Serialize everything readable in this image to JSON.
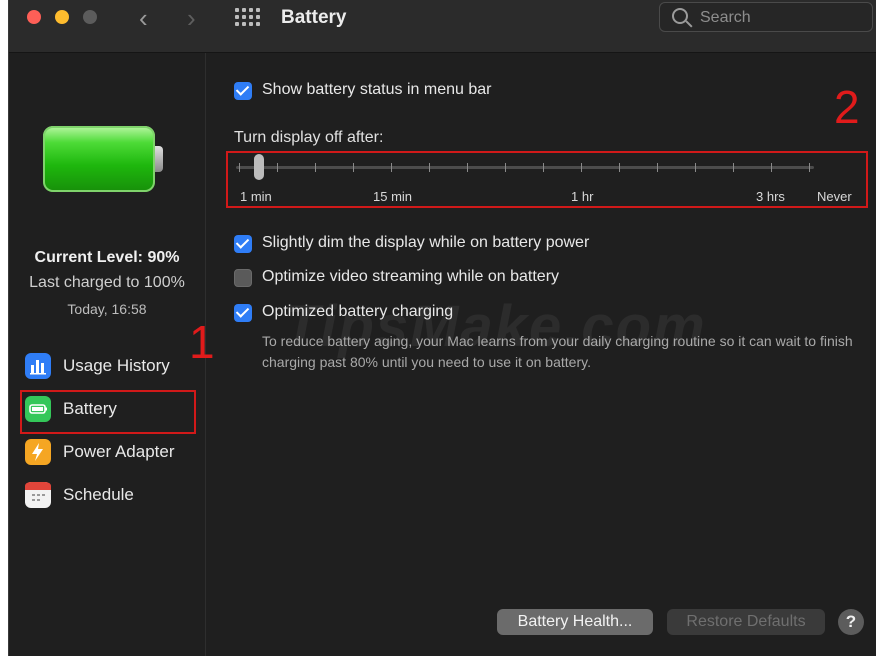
{
  "window": {
    "title": "Battery"
  },
  "search": {
    "placeholder": "Search"
  },
  "status": {
    "current_level": "Current Level: 90%",
    "last_charged": "Last charged to 100%",
    "time": "Today, 16:58",
    "level_fraction": 0.9
  },
  "sidebar": {
    "items": [
      {
        "label": "Usage History",
        "icon": "bar-chart-icon"
      },
      {
        "label": "Battery",
        "icon": "battery-icon"
      },
      {
        "label": "Power Adapter",
        "icon": "lightning-icon"
      },
      {
        "label": "Schedule",
        "icon": "calendar-icon"
      }
    ]
  },
  "settings": {
    "show_status": {
      "label": "Show battery status in menu bar",
      "checked": true
    },
    "display_off": {
      "label": "Turn display off after:",
      "tick_labels": [
        "1 min",
        "15 min",
        "1 hr",
        "3 hrs",
        "Never"
      ],
      "value": "1 min"
    },
    "dim": {
      "label": "Slightly dim the display while on battery power",
      "checked": true
    },
    "video": {
      "label": "Optimize video streaming while on battery",
      "checked": false
    },
    "optimized": {
      "label": "Optimized battery charging",
      "checked": true,
      "description": "To reduce battery aging, your Mac learns from your daily charging routine so it can wait to finish charging past 80% until you need to use it on battery."
    }
  },
  "buttons": {
    "battery_health": "Battery Health...",
    "restore_defaults": "Restore Defaults",
    "help": "?"
  },
  "annotations": {
    "one": "1",
    "two": "2"
  },
  "watermark": "TipsMake.com",
  "colors": {
    "accent": "#2f7df6",
    "annotation": "#d11919",
    "background": "#1f1f1f"
  }
}
